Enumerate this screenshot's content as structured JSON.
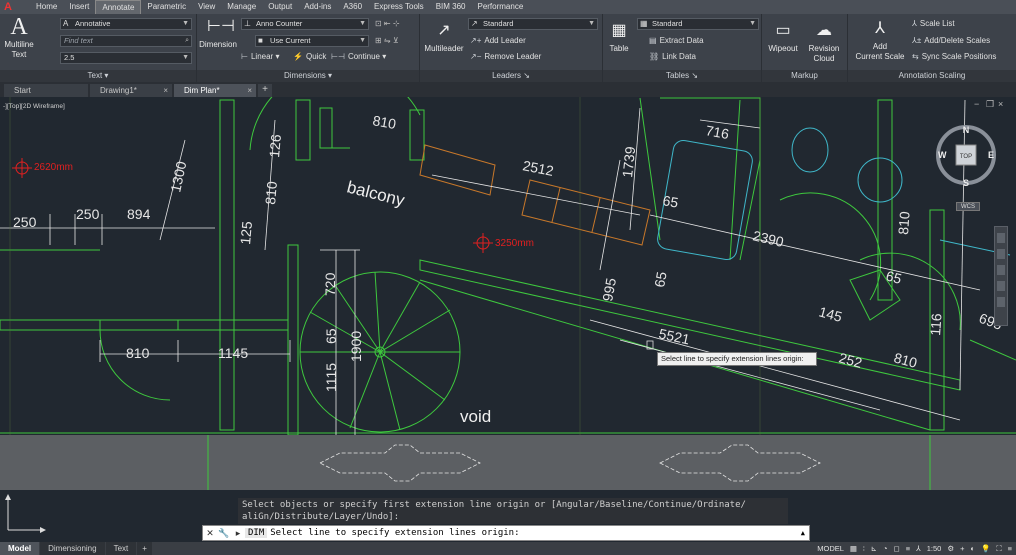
{
  "menubar": {
    "items": [
      "Home",
      "Insert",
      "Annotate",
      "Parametric",
      "View",
      "Manage",
      "Output",
      "Add-ins",
      "A360",
      "Express Tools",
      "BIM 360",
      "Performance"
    ],
    "active": "Annotate"
  },
  "ribbon": {
    "text_panel": {
      "big_label_1": "Multiline",
      "big_label_2": "Text",
      "style_combo": "Annotative",
      "find_placeholder": "Find text",
      "height_combo": "2.5",
      "title": "Text"
    },
    "dimensions_panel": {
      "big_label": "Dimension",
      "style_combo": "Anno Counter",
      "layer_combo": "Use Current",
      "linear": "Linear",
      "quick": "Quick",
      "continue": "Continue",
      "title": "Dimensions"
    },
    "leaders_panel": {
      "big_label": "Multileader",
      "style_combo": "Standard",
      "add": "Add Leader",
      "remove": "Remove Leader",
      "title": "Leaders"
    },
    "tables_panel": {
      "big_label": "Table",
      "style_combo": "Standard",
      "extract": "Extract Data",
      "link": "Link Data",
      "title": "Tables"
    },
    "markup_panel": {
      "wipeout": "Wipeout",
      "revcloud_1": "Revision",
      "revcloud_2": "Cloud",
      "title": "Markup"
    },
    "scaling_panel": {
      "big_label_1": "Add",
      "big_label_2": "Current Scale",
      "scale_list": "Scale List",
      "add_delete": "Add/Delete Scales",
      "sync": "Sync Scale Positions",
      "title": "Annotation Scaling"
    }
  },
  "doc_tabs": [
    {
      "label": "Start"
    },
    {
      "label": "Drawing1*"
    },
    {
      "label": "Dim Plan*"
    }
  ],
  "viewport_label": "-][Top][2D Wireframe]",
  "drawing": {
    "dims": [
      "810",
      "1300",
      "126",
      "810",
      "125",
      "250",
      "250",
      "894",
      "2512",
      "1739",
      "716",
      "65",
      "2390",
      "810",
      "65",
      "995",
      "720",
      "65",
      "1900",
      "1115",
      "810",
      "1145",
      "5521",
      "145",
      "252",
      "810",
      "116",
      "695",
      "65"
    ],
    "room_labels": [
      "balcony",
      "void"
    ],
    "level_marks": [
      "2620mm",
      "3250mm"
    ]
  },
  "tooltip": "Select line to specify extension lines origin:",
  "viewcube": {
    "n": "N",
    "s": "S",
    "w": "W",
    "e": "E",
    "top": "TOP",
    "wcs": "WCS"
  },
  "command": {
    "history_1": "Select objects or specify first extension line origin or [Angular/Baseline/Continue/Ordinate/",
    "history_2": "aliGn/Distribute/Layer/Undo]:",
    "prefix": "DIM",
    "prompt": "Select line to specify extension lines origin:"
  },
  "layout_tabs": [
    "Model",
    "Dimensioning",
    "Text"
  ],
  "status": {
    "model": "MODEL",
    "scale": "1:50"
  },
  "colors": {
    "green": "#3ec83e",
    "white": "#e6e6e6",
    "orange": "#c8782a",
    "cyan": "#3fb6c8",
    "red": "#e02020"
  }
}
